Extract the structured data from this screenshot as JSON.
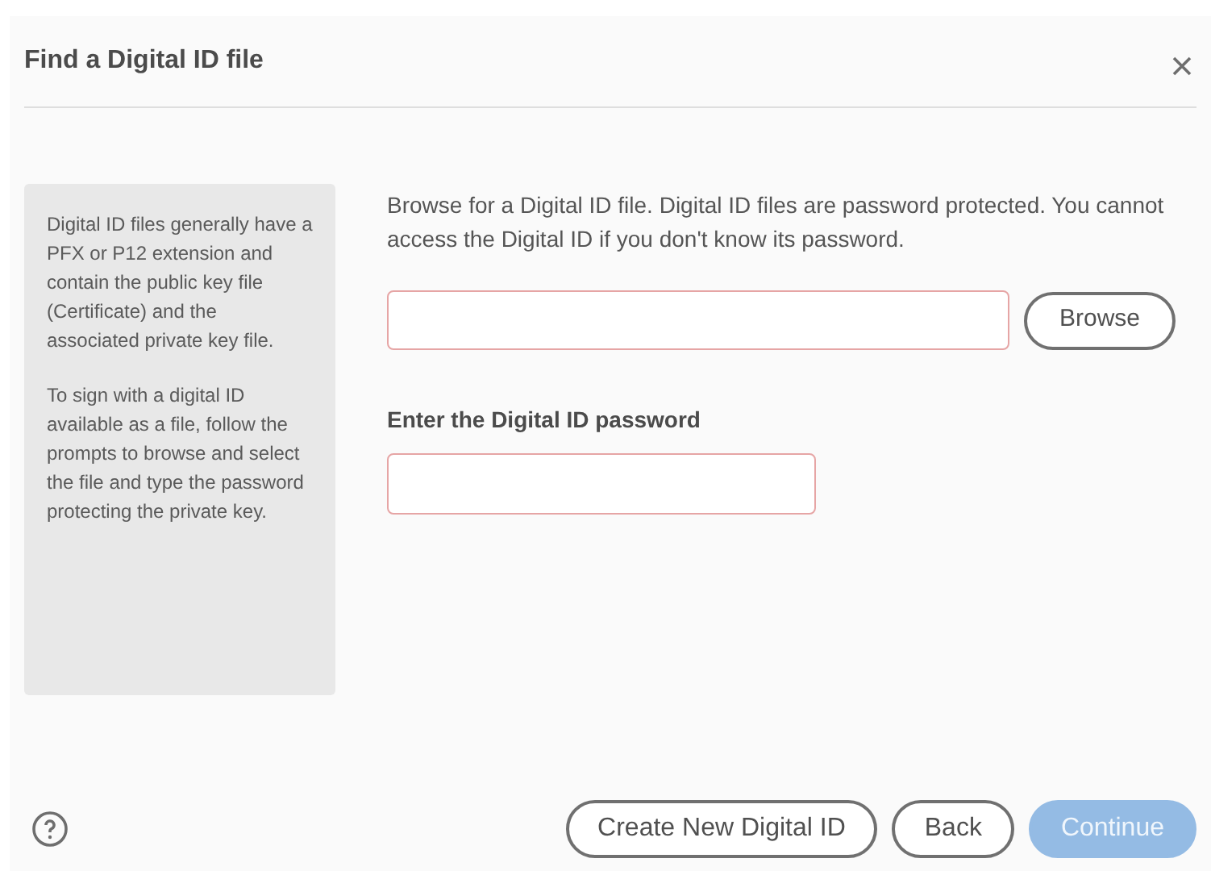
{
  "dialog": {
    "title": "Find a Digital ID file"
  },
  "sidebar": {
    "paragraphs": [
      "Digital ID files generally have a PFX or P12 extension and contain the public key file (Certificate) and the associated private key file.",
      "To sign with a digital ID available as a file, follow the prompts to browse and select the file and type the password protecting the private key."
    ]
  },
  "main": {
    "instructions": "Browse for a Digital ID file. Digital ID files are password protected. You cannot access the Digital ID if you don't know its password.",
    "browse_button": "Browse",
    "password_label": "Enter the Digital ID password"
  },
  "footer": {
    "buttons": [
      {
        "label": "Create New Digital ID",
        "disabled": false
      },
      {
        "label": "Back",
        "disabled": false
      },
      {
        "label": "Continue",
        "disabled": true,
        "kind": "primary"
      }
    ]
  }
}
